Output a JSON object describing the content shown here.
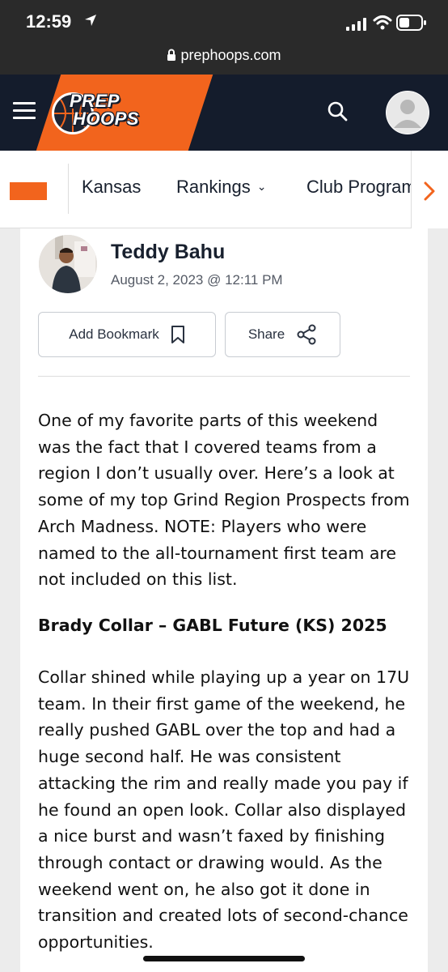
{
  "status_bar": {
    "time": "12:59",
    "url": "prephoops.com",
    "icons": [
      "location-arrow-icon",
      "signal-icon",
      "wifi-icon",
      "battery-icon"
    ]
  },
  "header": {
    "logo_line1": "PREP",
    "logo_line2": "HOOPS",
    "icons": [
      "menu-icon",
      "search-icon",
      "avatar-icon"
    ],
    "colors": {
      "background": "#141c2c",
      "accent": "#f2641d"
    }
  },
  "nav": {
    "items": [
      {
        "label": "Kansas"
      },
      {
        "label": "Rankings"
      },
      {
        "label": "Club Programs"
      }
    ]
  },
  "article": {
    "author": "Teddy Bahu",
    "date": "August 2, 2023 @ 12:11 PM",
    "bookmark_label": "Add Bookmark",
    "share_label": "Share",
    "intro": "One of my favorite parts of this weekend was the fact that I covered teams from a region I don’t usually over. Here’s a look at some of my top Grind Region Prospects from Arch Madness. NOTE: Players who were named to the all-tournament first team are not included on this list.",
    "player_heading": "Brady Collar – GABL Future (KS) 2025",
    "player_paragraph": "Collar shined while playing up a year on 17U team. In their first game of the weekend, he really pushed GABL over the top and had a huge second half. He was consistent attacking the rim and really made you pay if he found an open look. Collar also displayed a nice burst and wasn’t faxed by finishing through contact or drawing would. As the weekend went on, he also got it done in transition and created lots of second-chance opportunities."
  }
}
